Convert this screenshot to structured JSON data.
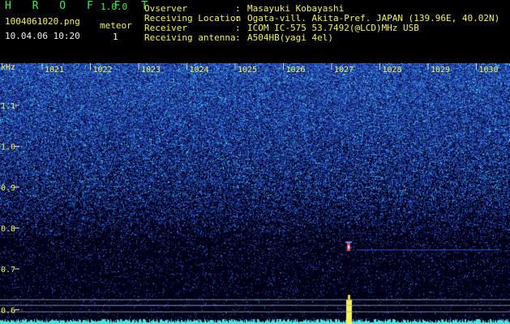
{
  "header": {
    "app_title": "H R O F F T",
    "app_version": "1.0.0",
    "file_name": "1004061020.png",
    "timestamp": "10.04.06 10:20",
    "mode_label": "meteor",
    "count": "1"
  },
  "info": {
    "observer_label": "Ovserver",
    "observer_value": "Masayuki Kobayashi",
    "location_label": "Receiving Location",
    "location_value": "Ogata-vill. Akita-Pref. JAPAN (139.96E, 40.02N)",
    "receiver_label": "Receiver",
    "receiver_value": "ICOM IC-575 53.7492(@LCD)MHz USB",
    "antenna_label": "Receiving antenna",
    "antenna_value": "A504HB(yagi 4el)",
    "separator": ":"
  },
  "spectrogram": {
    "y_unit": "kHz",
    "x_ticks": [
      "1021",
      "1022",
      "1023",
      "1024",
      "1025",
      "1026",
      "1027",
      "1028",
      "1029",
      "1030"
    ],
    "y_ticks": [
      "1.1",
      "1.0",
      "0.9",
      "0.8",
      "0.7",
      "0.6"
    ],
    "colors": {
      "noise_low": "#0a0a3a",
      "noise_high": "#3a6cff",
      "speckle": "#4fe0e0",
      "tick_text": "#f3f35a",
      "marker_line": "#9aa4a8",
      "echo_head": "#ff3b5a",
      "echo_bar": "#f3f35a",
      "baseline": "#4fe0e0"
    }
  }
}
